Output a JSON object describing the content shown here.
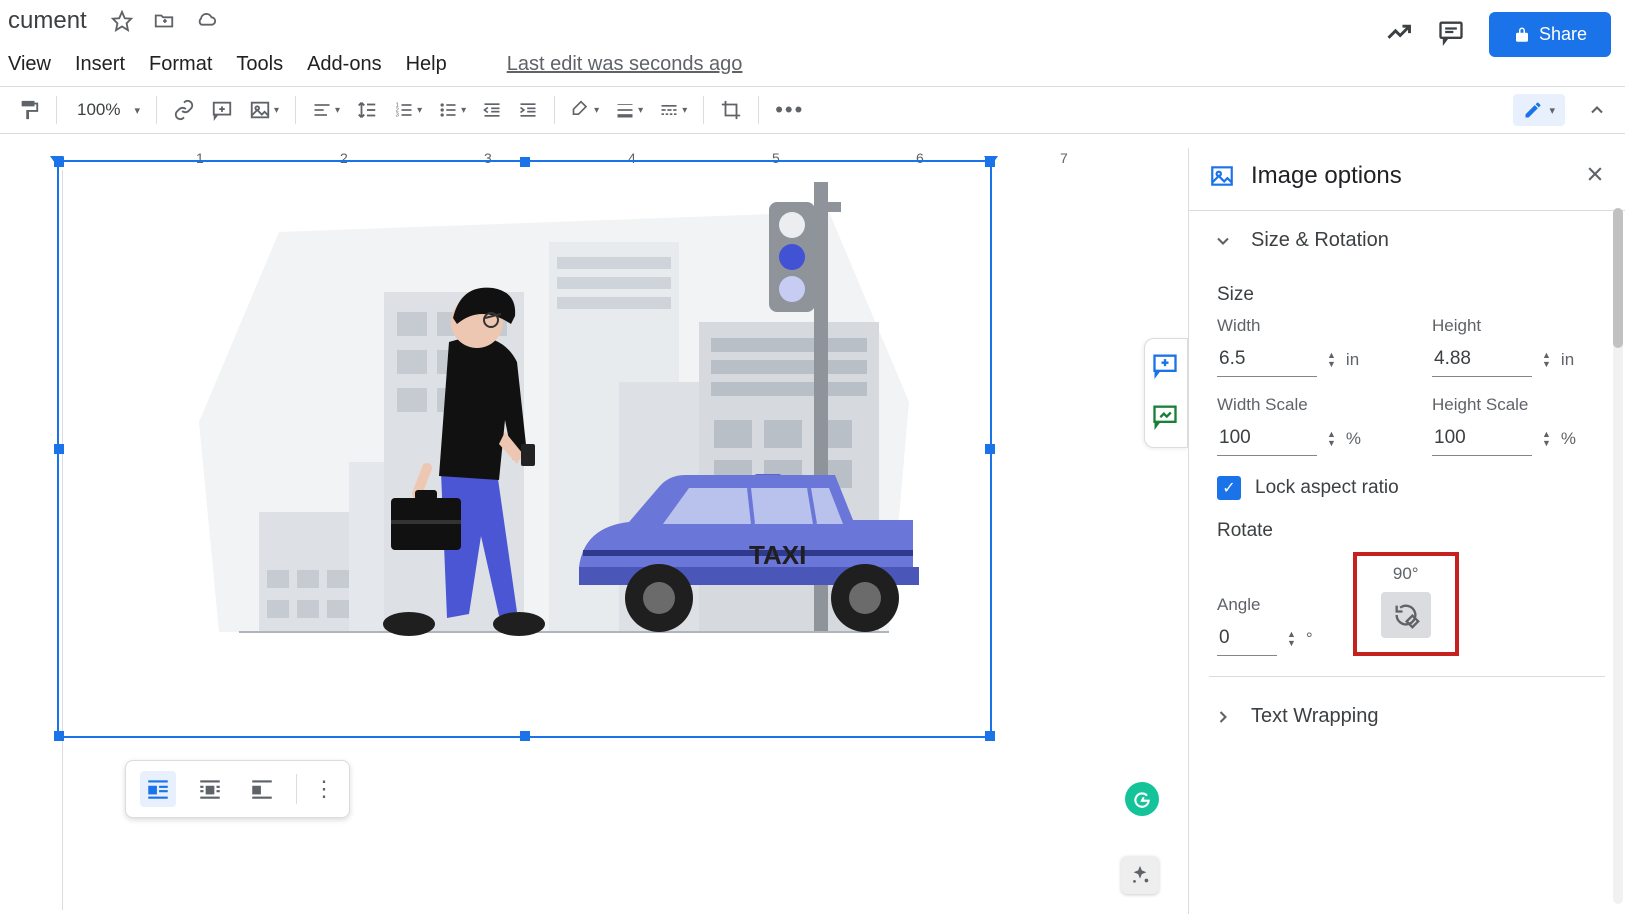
{
  "title_bar": {
    "document_title": "cument"
  },
  "top_right": {
    "share_label": "Share"
  },
  "menus": {
    "view": "View",
    "insert": "Insert",
    "format": "Format",
    "tools": "Tools",
    "addons": "Add-ons",
    "help": "Help",
    "last_edit": "Last edit was seconds ago"
  },
  "toolbar": {
    "zoom": "100%"
  },
  "ruler": {
    "n1": "1",
    "n2": "2",
    "n3": "3",
    "n4": "4",
    "n5": "5",
    "n6": "6",
    "n7": "7"
  },
  "illustration": {
    "taxi_label": "TAXI"
  },
  "sidebar": {
    "title": "Image options",
    "size_rotation": {
      "header": "Size & Rotation",
      "size_label": "Size",
      "width_label": "Width",
      "height_label": "Height",
      "width_value": "6.5",
      "height_value": "4.88",
      "unit_in": "in",
      "width_scale_label": "Width Scale",
      "height_scale_label": "Height Scale",
      "width_scale_value": "100",
      "height_scale_value": "100",
      "unit_pct": "%",
      "lock_aspect": "Lock aspect ratio",
      "rotate_label": "Rotate",
      "angle_label": "Angle",
      "angle_value": "0",
      "unit_deg": "°",
      "ninety_label": "90°"
    },
    "text_wrapping": {
      "header": "Text Wrapping"
    }
  },
  "grammarly": {
    "glyph": "G"
  }
}
